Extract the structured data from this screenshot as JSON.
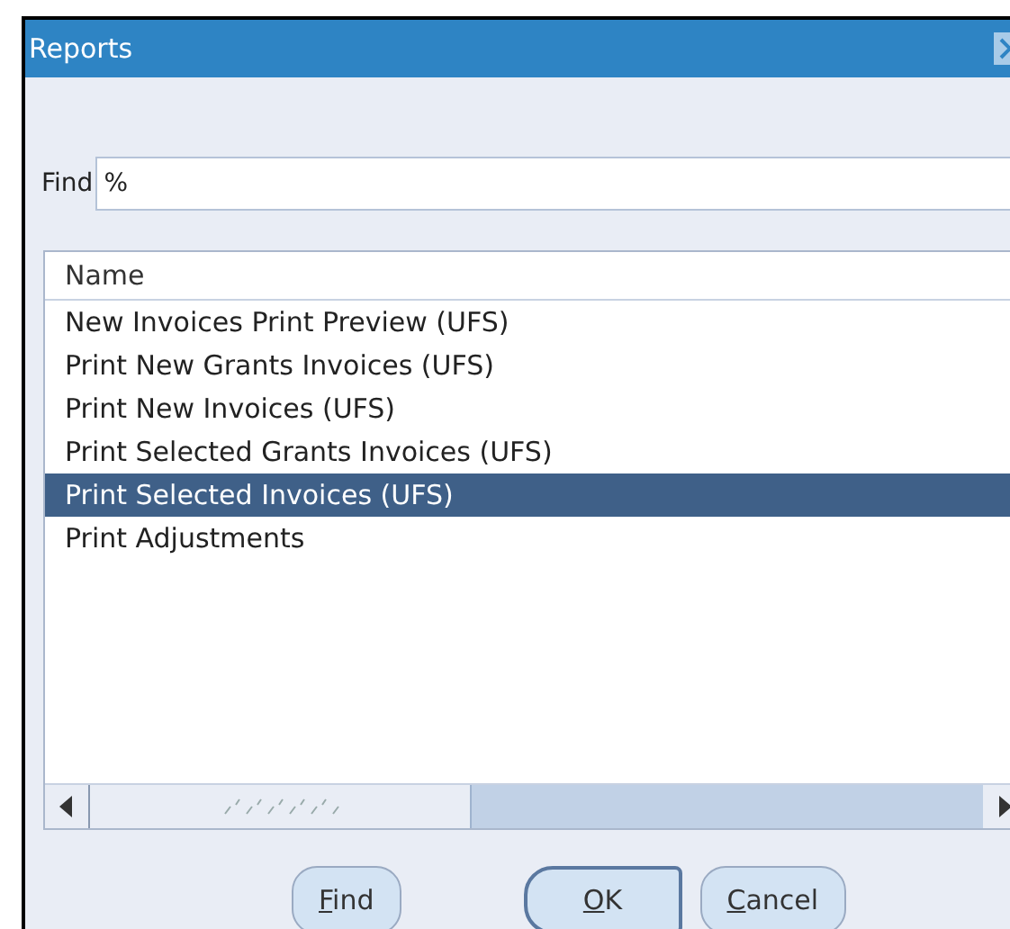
{
  "window": {
    "title": "Reports"
  },
  "find": {
    "label": "Find",
    "value": "%"
  },
  "list": {
    "column": "Name",
    "rows": [
      {
        "label": "New Invoices Print Preview (UFS)",
        "selected": false
      },
      {
        "label": "Print New Grants Invoices (UFS)",
        "selected": false
      },
      {
        "label": "Print New Invoices (UFS)",
        "selected": false
      },
      {
        "label": "Print Selected Grants Invoices (UFS)",
        "selected": false
      },
      {
        "label": "Print Selected Invoices (UFS)",
        "selected": true
      },
      {
        "label": "Print Adjustments",
        "selected": false
      }
    ]
  },
  "buttons": [
    {
      "label": "Find",
      "default": false
    },
    {
      "label": "OK",
      "default": true
    },
    {
      "label": "Cancel",
      "default": false
    }
  ]
}
